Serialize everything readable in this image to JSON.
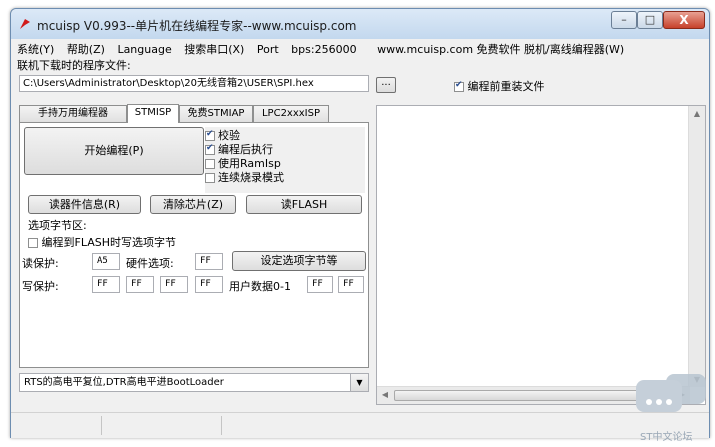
{
  "window": {
    "title": "mcuisp V0.993--单片机在线编程专家--www.mcuisp.com",
    "min_glyph": "–",
    "max_glyph": "□",
    "close_glyph": "X"
  },
  "menu": {
    "items": [
      "系统(Y)",
      "帮助(Z)",
      "Language",
      "搜索串口(X)",
      "Port",
      "bps:256000"
    ],
    "right_text": "www.mcuisp.com 免费软件 脱机/离线编程器(W)"
  },
  "file": {
    "label": "联机下载时的程序文件:",
    "path": "C:\\Users\\Administrator\\Desktop\\20无线音箱2\\USER\\SPI.hex",
    "browse_label": "...",
    "reload_label": "编程前重装文件",
    "reload_checked": true
  },
  "tabs": [
    {
      "label": "手持万用编程器",
      "active": false
    },
    {
      "label": "STMISP",
      "active": true
    },
    {
      "label": "免费STMIAP",
      "active": false
    },
    {
      "label": "LPC2xxxISP",
      "active": false
    }
  ],
  "stmisp": {
    "start_button": "开始编程(P)",
    "options": [
      {
        "label": "校验",
        "checked": true
      },
      {
        "label": "编程后执行",
        "checked": true
      },
      {
        "label": "使用RamIsp",
        "checked": false
      },
      {
        "label": "连续烧录模式",
        "checked": false
      }
    ],
    "read_info_button": "读器件信息(R)",
    "erase_button": "清除芯片(Z)",
    "read_flash_button": "读FLASH",
    "option_bytes_label": "选项字节区:",
    "write_option_label": "编程到FLASH时写选项字节",
    "write_option_checked": false,
    "read_protect_label": "读保护:",
    "read_protect_value": "A5",
    "hw_option_label": "硬件选项:",
    "hw_option_value": "FF",
    "set_option_button": "设定选项字节等",
    "write_protect_label": "写保护:",
    "write_protect_values": [
      "FF",
      "FF",
      "FF",
      "FF"
    ],
    "user_data_label": "用户数据0-1",
    "user_data_values": [
      "FF",
      "FF"
    ]
  },
  "boot_mode": {
    "selected": "RTS的高电平复位,DTR高电平进BootLoader"
  },
  "watermark": {
    "text": "ST中文论坛"
  }
}
